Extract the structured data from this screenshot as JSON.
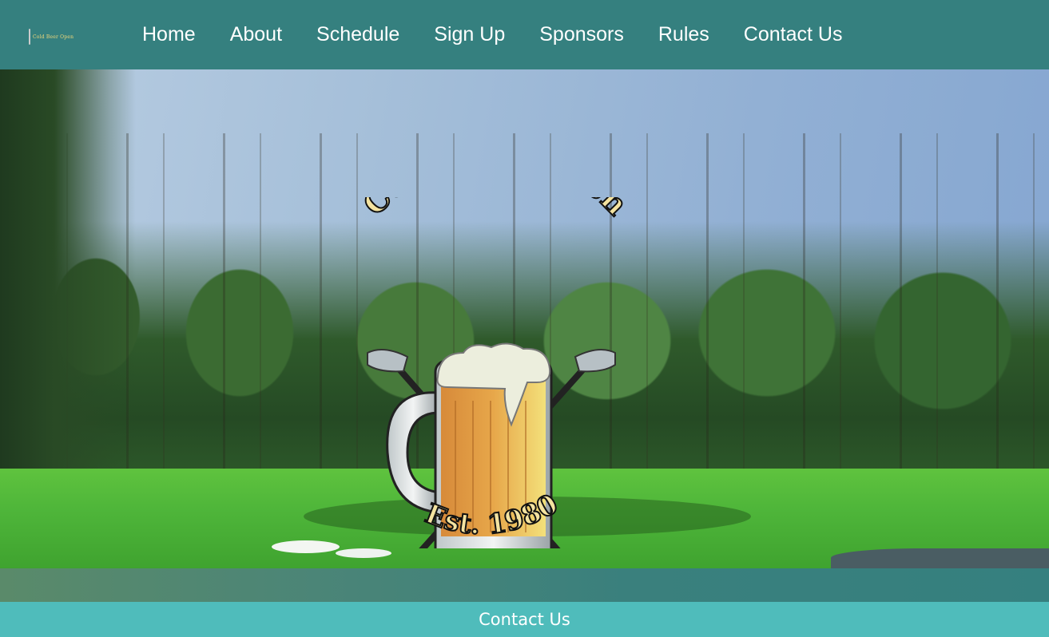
{
  "header": {
    "logo_icon": "beer-mug-logo-icon",
    "nav": [
      {
        "label": "Home"
      },
      {
        "label": "About"
      },
      {
        "label": "Schedule"
      },
      {
        "label": "Sign Up"
      },
      {
        "label": "Sponsors"
      },
      {
        "label": "Rules"
      },
      {
        "label": "Contact Us"
      }
    ]
  },
  "hero": {
    "emblem_title": "Cold Beer Open",
    "emblem_subtitle": "Est. 1980"
  },
  "footer": {
    "contact_label": "Contact Us"
  },
  "colors": {
    "header_bg": "#35807f",
    "footer_bg": "#4fbcbb",
    "nav_text": "#ffffff"
  }
}
